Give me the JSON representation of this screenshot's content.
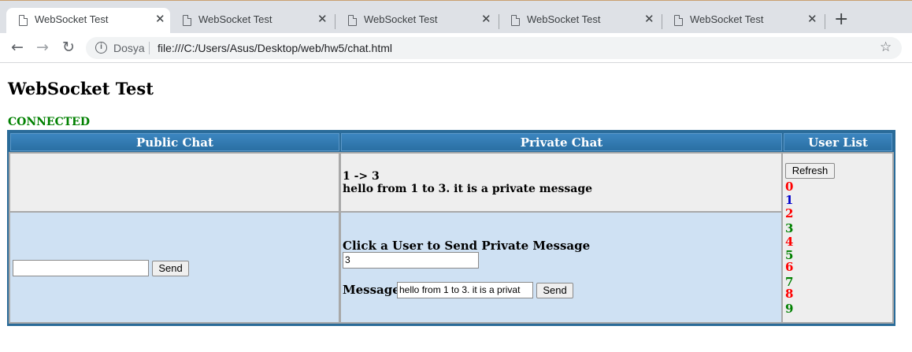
{
  "browser": {
    "tabs": [
      {
        "title": "WebSocket Test",
        "close": "✕"
      },
      {
        "title": "WebSocket Test",
        "close": "✕"
      },
      {
        "title": "WebSocket Test",
        "close": "✕"
      },
      {
        "title": "WebSocket Test",
        "close": "✕"
      },
      {
        "title": "WebSocket Test",
        "close": "✕"
      }
    ],
    "new_tab": "+",
    "nav": {
      "back": "←",
      "forward": "→",
      "reload": "↻"
    },
    "address": {
      "info_icon": "i",
      "label": "Dosya",
      "url": "file:///C:/Users/Asus/Desktop/web/hw5/chat.html"
    },
    "bookmark_star": "☆"
  },
  "page": {
    "title": "WebSocket Test",
    "status": "CONNECTED",
    "status_color": "#008000",
    "headers": {
      "public": "Public Chat",
      "private": "Private Chat",
      "users": "User List"
    },
    "private_messages": [
      "1 -> 3",
      "hello from 1 to 3. it is a private message"
    ],
    "public_input": {
      "value": "",
      "send_label": "Send"
    },
    "private_form": {
      "prompt": "Click a User to Send Private Message",
      "recipient_value": "3",
      "message_label": "Message",
      "message_value": "hello from 1 to 3. it is a privat",
      "send_label": "Send"
    },
    "refresh_label": "Refresh",
    "users": [
      {
        "name": "0",
        "color": "#ff0000"
      },
      {
        "name": "1",
        "color": "#0000cc"
      },
      {
        "name": "2",
        "color": "#ff0000"
      },
      {
        "name": "3",
        "color": "#008000"
      },
      {
        "name": "4",
        "color": "#ff0000"
      },
      {
        "name": "5",
        "color": "#008000"
      },
      {
        "name": "6",
        "color": "#ff0000"
      },
      {
        "name": "7",
        "color": "#008000"
      },
      {
        "name": "8",
        "color": "#ff0000"
      },
      {
        "name": "9",
        "color": "#008000"
      }
    ]
  }
}
